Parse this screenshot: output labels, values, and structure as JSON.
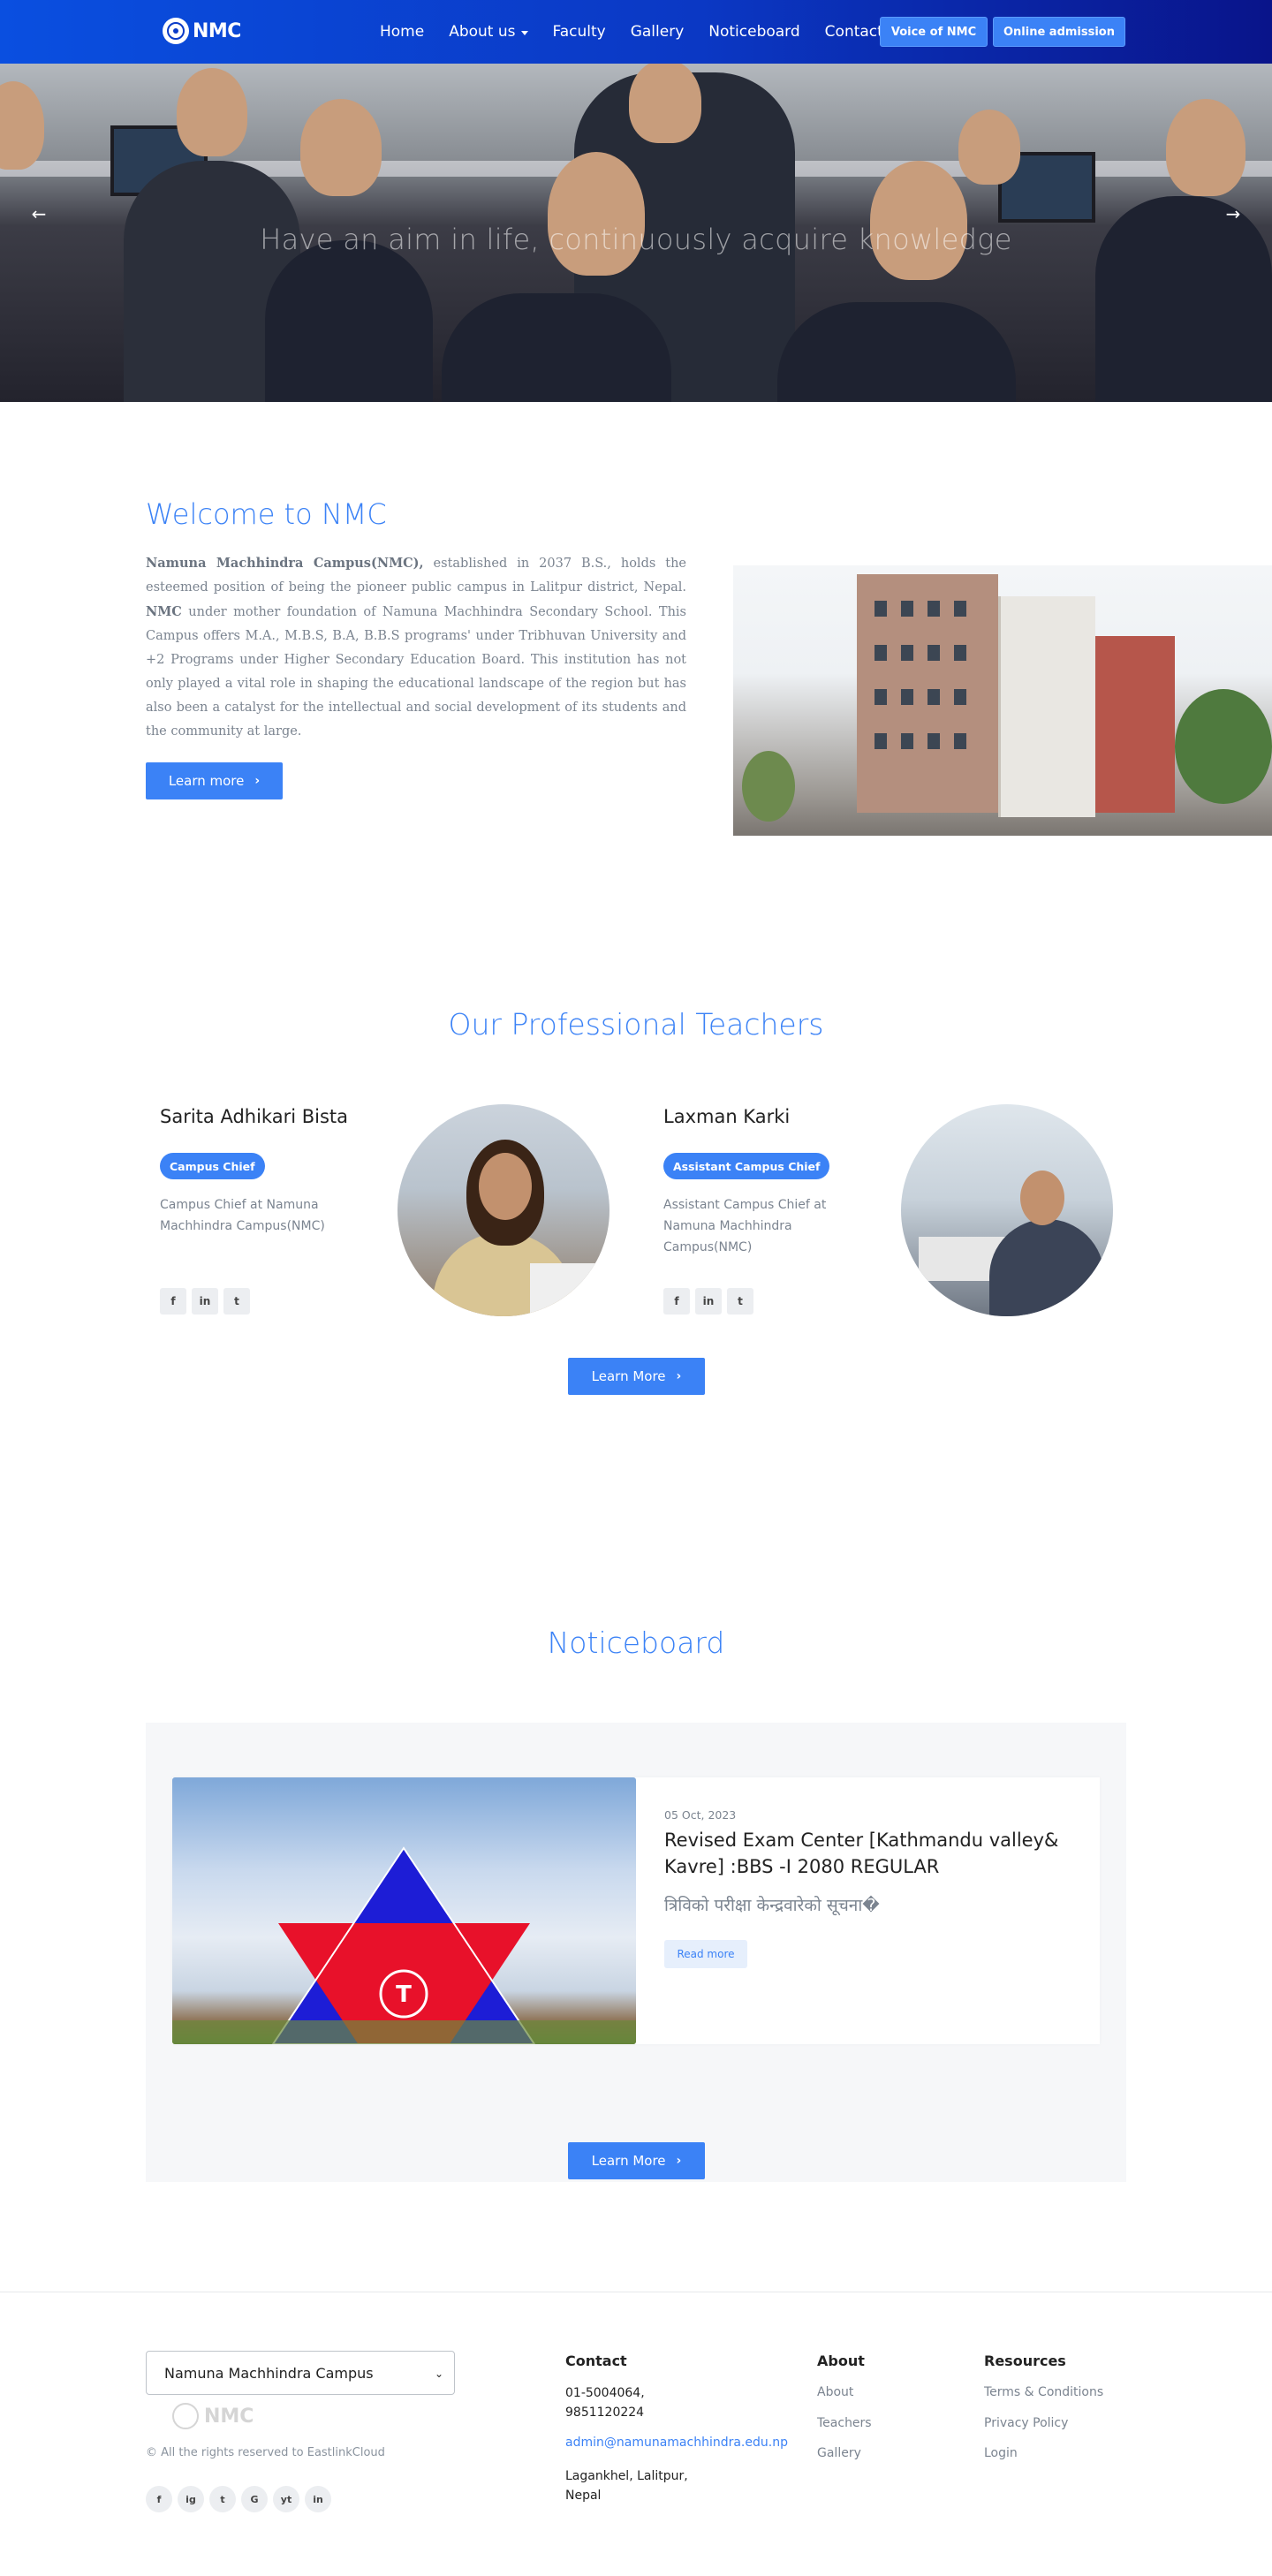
{
  "nav": {
    "brand": "NMC",
    "links": [
      "Home",
      "About us",
      "Faculty",
      "Gallery",
      "Noticeboard",
      "Contact"
    ],
    "voice_btn": "Voice of NMC",
    "admission_btn": "Online admission"
  },
  "hero": {
    "tagline": "Have an aim in life, continuously acquire knowledge",
    "prev_icon": "←",
    "next_icon": "→"
  },
  "welcome": {
    "title": "Welcome to NMC",
    "p1_bold": "Namuna Machhindra Campus(NMC),",
    "p1": " established in 2037 B.S., holds the esteemed position of being the pioneer public campus in Lalitpur district, Nepal. ",
    "p2_bold": "NMC",
    "p2": " under mother foundation of Namuna Machhindra Secondary School. This Campus offers M.A., M.B.S, B.A, B.B.S programs' under Tribhuvan University and +2 Programs under Higher Secondary Education Board. This institution has not only played a vital role in shaping the educational landscape of the region but has also been a catalyst for the intellectual and social development of its students and the community at large.",
    "btn": "Learn more"
  },
  "teachers": {
    "title": "Our Professional Teachers",
    "list": [
      {
        "name": "Sarita Adhikari Bista",
        "role": "Campus Chief",
        "desc": "Campus Chief at Namuna Machhindra Campus(NMC)"
      },
      {
        "name": "Laxman Karki",
        "role": "Assistant Campus Chief",
        "desc": "Assistant Campus Chief at Namuna Machhindra Campus(NMC)"
      }
    ],
    "social": [
      "f",
      "in",
      "t"
    ],
    "btn": "Learn More"
  },
  "noticeboard": {
    "title": "Noticeboard",
    "date": "05 Oct, 2023",
    "heading": "Revised Exam Center [Kathmandu valley& Kavre] :BBS -I 2080 REGULAR",
    "sub": "त्रिविको परीक्षा केन्द्रवारेको सूचना�",
    "read_more": "Read more",
    "btn": "Learn More"
  },
  "footer": {
    "select_value": "Namuna Machhindra Campus",
    "logo": "NMC",
    "copyright": "© All the rights reserved to EastlinkCloud",
    "social": [
      "f",
      "ig",
      "t",
      "G",
      "yt",
      "in"
    ],
    "contact": {
      "heading": "Contact",
      "phone1": "01-5004064,",
      "phone2": "9851120224",
      "email": "admin@namunamachhindra.edu.np",
      "addr1": "Lagankhel, Lalitpur,",
      "addr2": "Nepal"
    },
    "about": {
      "heading": "About",
      "links": [
        "About",
        "Teachers",
        "Gallery"
      ]
    },
    "resources": {
      "heading": "Resources",
      "links": [
        "Terms & Conditions",
        "Privacy Policy",
        "Login"
      ]
    }
  }
}
